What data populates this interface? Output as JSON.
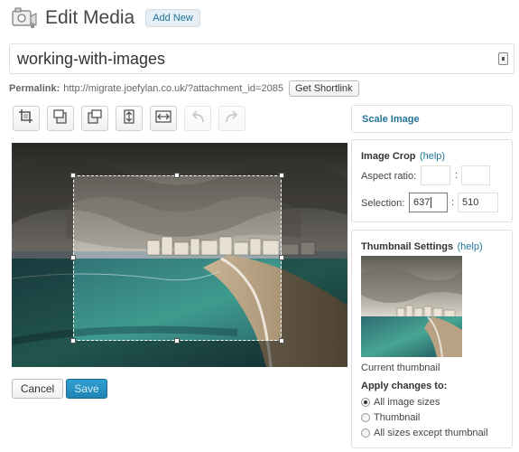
{
  "header": {
    "title": "Edit Media",
    "add_new_label": "Add New",
    "icon": "media-library-icon"
  },
  "title_field": {
    "value": "working-with-images"
  },
  "permalink": {
    "label": "Permalink:",
    "url": "http://migrate.joefylan.co.uk/?attachment_id=2085",
    "shortlink_label": "Get Shortlink"
  },
  "toolbar": {
    "items": [
      {
        "icon": "crop-icon"
      },
      {
        "icon": "rotate-counter-clockwise-icon"
      },
      {
        "icon": "rotate-clockwise-icon"
      },
      {
        "icon": "flip-vertical-icon"
      },
      {
        "icon": "flip-horizontal-icon"
      },
      {
        "icon": "undo-icon",
        "disabled": true
      },
      {
        "icon": "redo-icon",
        "disabled": true
      }
    ]
  },
  "actions": {
    "cancel_label": "Cancel",
    "save_label": "Save"
  },
  "scale_panel": {
    "title": "Scale Image"
  },
  "crop_panel": {
    "title": "Image Crop",
    "help": "(help)",
    "aspect_label": "Aspect ratio:",
    "aspect_w": "",
    "aspect_h": "",
    "colon": ":",
    "selection_label": "Selection:",
    "selection_w": "637",
    "selection_h": "510"
  },
  "thumb_panel": {
    "title": "Thumbnail Settings",
    "help": "(help)",
    "current_label": "Current thumbnail",
    "apply_label": "Apply changes to:",
    "options": [
      {
        "label": "All image sizes",
        "checked": true
      },
      {
        "label": "Thumbnail",
        "checked": false
      },
      {
        "label": "All sizes except thumbnail",
        "checked": false
      }
    ]
  },
  "colors": {
    "link": "#21759b",
    "primary_button": "#2184b3"
  }
}
